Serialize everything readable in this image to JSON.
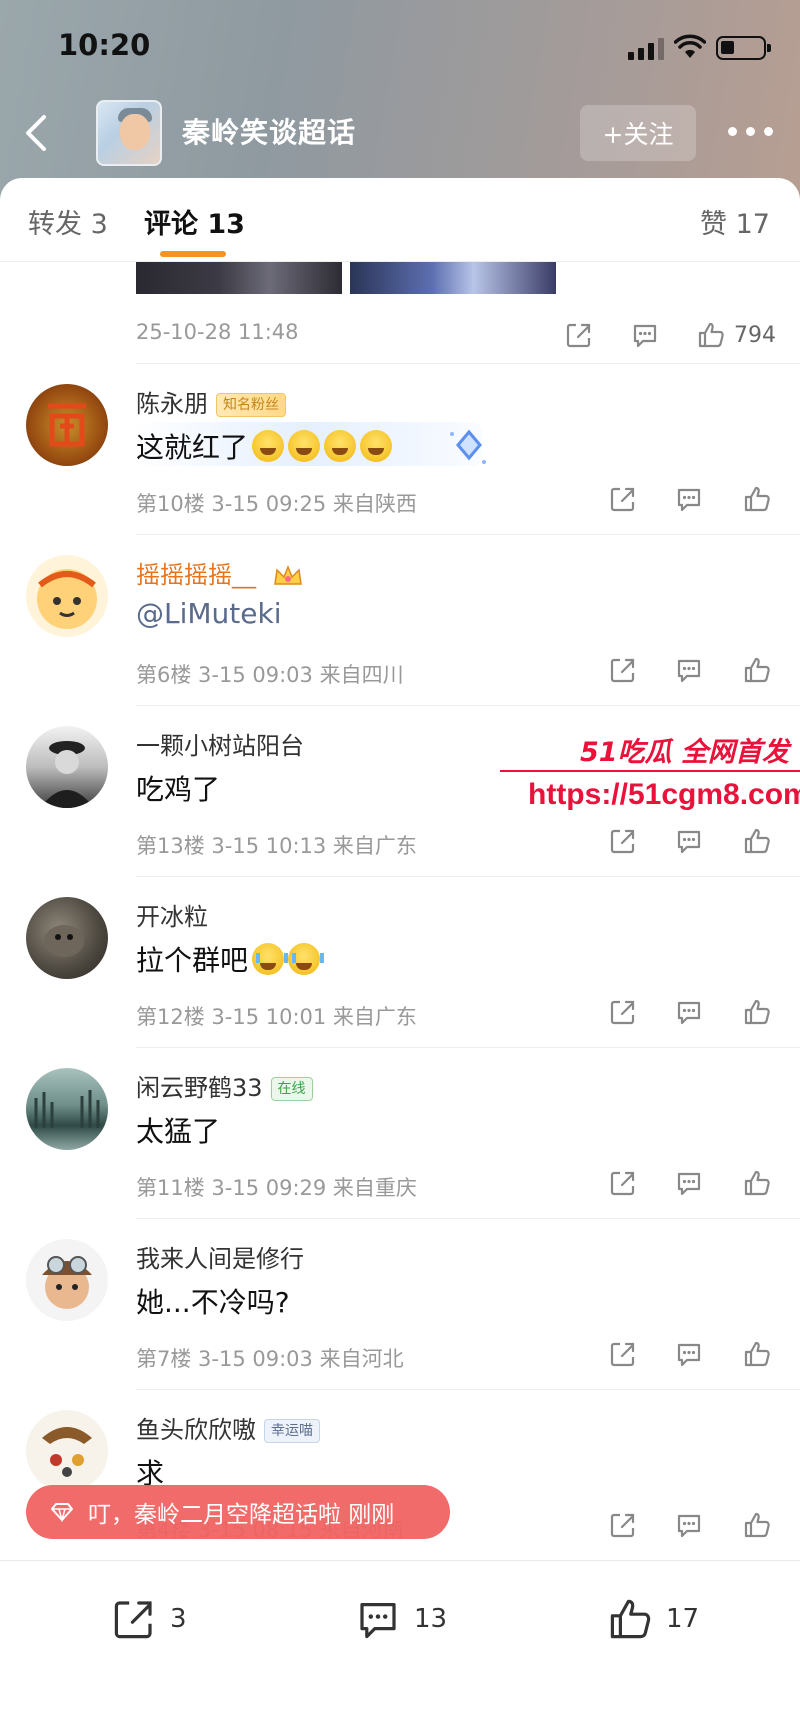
{
  "status_bar": {
    "time": "10:20"
  },
  "nav": {
    "topic_name": "秦岭笑谈超话",
    "follow_label": "+关注"
  },
  "tabs": {
    "repost": "转发 3",
    "comment": "评论 13",
    "like": "赞 17"
  },
  "prev_post": {
    "time": "25-10-28 11:48",
    "like_count": "794"
  },
  "comments": [
    {
      "name": "陈永朋",
      "badge": "知名粉丝",
      "text": "这就红了",
      "meta": "第10楼 3-15 09:25 来自陕西"
    },
    {
      "name": "摇摇摇摇__",
      "text": "@LiMuteki",
      "meta": "第6楼 3-15 09:03 来自四川"
    },
    {
      "name": "一颗小树站阳台",
      "text": "吃鸡了",
      "meta": "第13楼 3-15 10:13 来自广东"
    },
    {
      "name": "开冰粒",
      "text": "拉个群吧",
      "meta": "第12楼 3-15 10:01 来自广东"
    },
    {
      "name": "闲云野鹤33",
      "badge": "在线",
      "text": "太猛了",
      "meta": "第11楼 3-15 09:29 来自重庆"
    },
    {
      "name": "我来人间是修行",
      "text": "她...不冷吗?",
      "meta": "第7楼 3-15 09:03 来自河北"
    },
    {
      "name": "鱼头欣欣嗷",
      "badge": "幸运喵",
      "text": "求",
      "meta": "第4楼 3-15 08:15 来自河南"
    }
  ],
  "watermark": {
    "title": "51吃瓜 全网首发",
    "url": "https://51cgm8.com"
  },
  "toast": {
    "text": "叮，秦岭二月空降超话啦 刚刚"
  },
  "bottom_bar": {
    "repost_count": "3",
    "comment_count": "13",
    "like_count": "17"
  },
  "colors": {
    "accent": "#f59322",
    "toast": "#f16262",
    "watermark": "#e8123a",
    "orange_name": "#e8731a"
  }
}
